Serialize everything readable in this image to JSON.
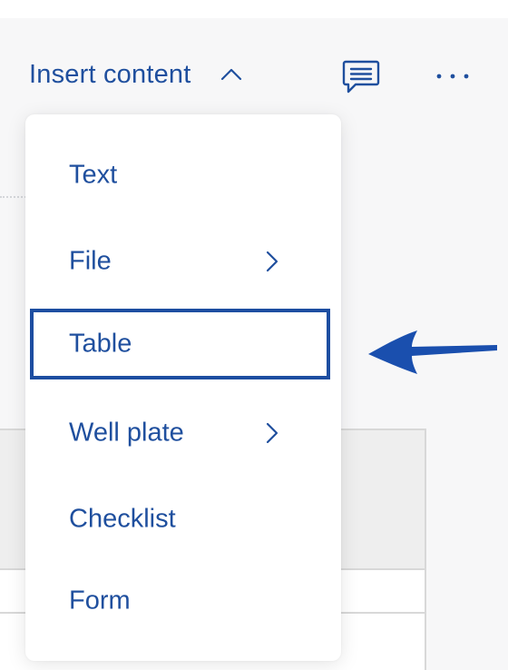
{
  "toolbar": {
    "insert_label": "Insert content",
    "icons": {
      "collapse": "chevron-up-icon",
      "comment": "comment-icon",
      "more": "more-horizontal-icon"
    }
  },
  "menu": {
    "items": [
      {
        "label": "Text",
        "has_submenu": false
      },
      {
        "label": "File",
        "has_submenu": true
      },
      {
        "label": "Table",
        "has_submenu": false,
        "highlighted": true
      },
      {
        "label": "Well plate",
        "has_submenu": true
      },
      {
        "label": "Checklist",
        "has_submenu": false
      },
      {
        "label": "Form",
        "has_submenu": false
      }
    ]
  },
  "colors": {
    "accent": "#1f4f9e",
    "highlight_border": "#1d4ea1",
    "annotation_arrow": "#1a4fae",
    "background": "#f7f7f8"
  }
}
